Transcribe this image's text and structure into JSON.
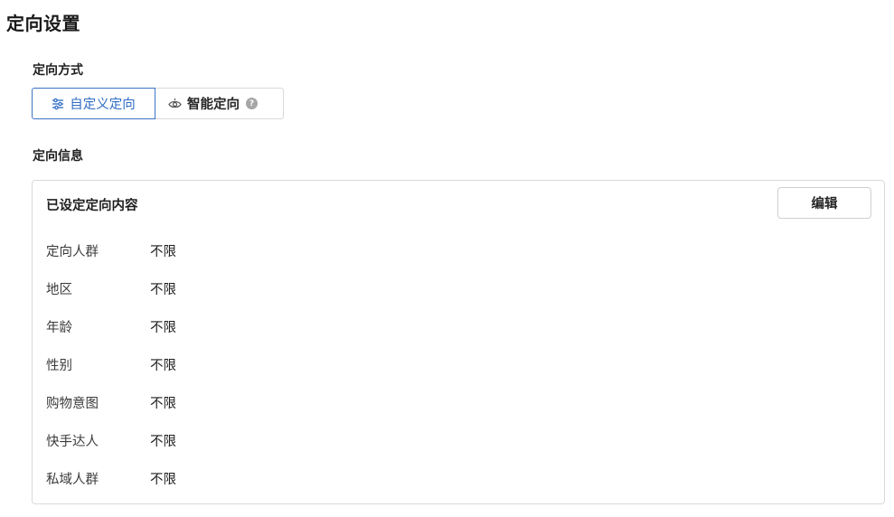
{
  "page": {
    "title": "定向设置"
  },
  "targeting_mode": {
    "label": "定向方式",
    "options": [
      {
        "label": "自定义定向",
        "icon": "sliders-icon",
        "selected": true
      },
      {
        "label": "智能定向",
        "icon": "smart-eye-icon",
        "selected": false,
        "help_icon": "question-circle-icon"
      }
    ]
  },
  "targeting_info": {
    "label": "定向信息",
    "card_title": "已设定定向内容",
    "edit_label": "编辑",
    "rows": [
      {
        "key": "定向人群",
        "value": "不限"
      },
      {
        "key": "地区",
        "value": "不限"
      },
      {
        "key": "年龄",
        "value": "不限"
      },
      {
        "key": "性别",
        "value": "不限"
      },
      {
        "key": "购物意图",
        "value": "不限"
      },
      {
        "key": "快手达人",
        "value": "不限"
      },
      {
        "key": "私域人群",
        "value": "不限"
      }
    ]
  },
  "colors": {
    "accent": "#2f6cc4",
    "border": "#d9d9d9",
    "help_icon": "#a6a6a6"
  }
}
